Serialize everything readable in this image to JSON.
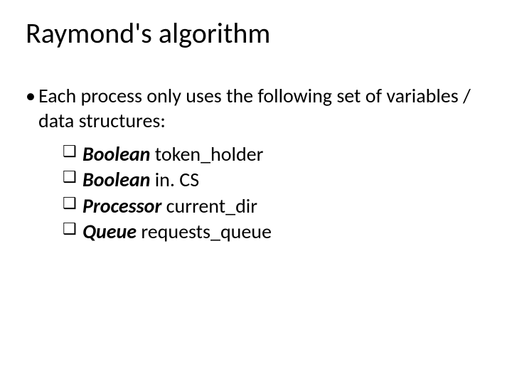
{
  "title": "Raymond's algorithm",
  "intro": "Each process only uses the following set of variables / data structures:",
  "vars": [
    {
      "type": "Boolean",
      "name": "token_holder"
    },
    {
      "type": "Boolean",
      "name": "in. CS"
    },
    {
      "type": "Processor",
      "name": "current_dir"
    },
    {
      "type": "Queue",
      "name": "requests_queue"
    }
  ]
}
